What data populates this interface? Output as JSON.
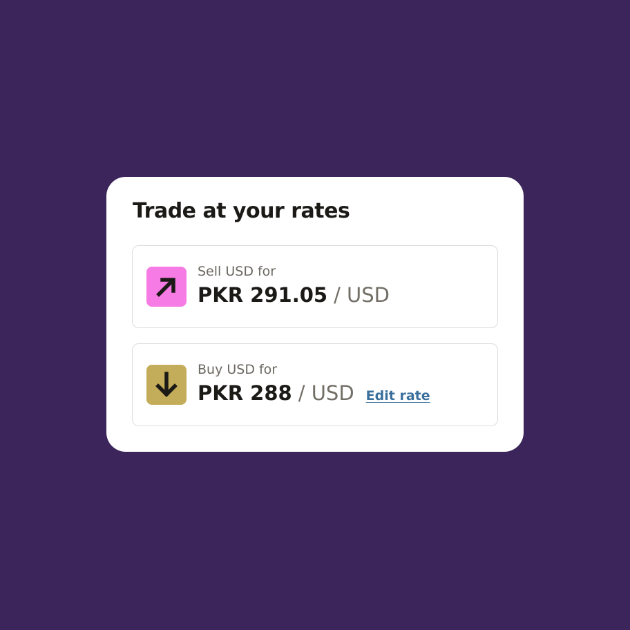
{
  "card": {
    "title": "Trade at your rates"
  },
  "sell": {
    "label": "Sell USD for",
    "amount": "PKR 291.05",
    "unit": "/ USD",
    "icon": "arrow-up-right-icon",
    "icon_color": "#f77be4"
  },
  "buy": {
    "label": "Buy USD for",
    "amount": "PKR 288",
    "unit": "/ USD",
    "edit_label": "Edit rate",
    "icon": "arrow-down-icon",
    "icon_color": "#c4ad5a"
  },
  "colors": {
    "background": "#3c255a",
    "card": "#ffffff",
    "link": "#3a6f9c"
  }
}
